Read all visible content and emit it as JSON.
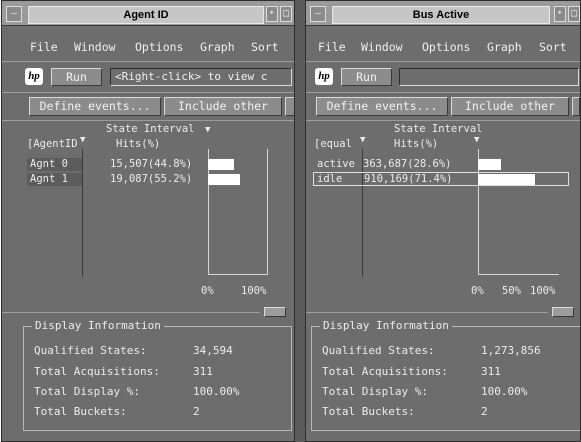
{
  "windows": [
    {
      "title": "Agent ID",
      "menu": [
        "File",
        "Window",
        "Options",
        "Graph",
        "Sort"
      ],
      "run_label": "Run",
      "message": "<Right-click> to view c",
      "define_events_label": "Define events...",
      "include_other_label": "Include other",
      "state_interval_label": "State Interval",
      "col_name": "[AgentID",
      "col_hits": "Hits(%)",
      "rows": [
        {
          "name": "Agnt 0",
          "hits": "15,507(44.8%)",
          "pct": 44.8
        },
        {
          "name": "Agnt 1",
          "hits": "19,087(55.2%)",
          "pct": 55.2
        }
      ],
      "scale_labels": [
        "0%",
        "100%"
      ],
      "display_info_label": "Display Information",
      "info": [
        {
          "label": "Qualified States:",
          "value": "34,594"
        },
        {
          "label": "Total Acquisitions:",
          "value": "311"
        },
        {
          "label": "Total Display %:",
          "value": "100.00%"
        },
        {
          "label": "Total Buckets:",
          "value": "2"
        }
      ]
    },
    {
      "title": "Bus Active",
      "menu": [
        "File",
        "Window",
        "Options",
        "Graph",
        "Sort"
      ],
      "run_label": "Run",
      "message": "",
      "define_events_label": "Define events...",
      "include_other_label": "Include other",
      "state_interval_label": "State Interval",
      "col_name": "[equal",
      "col_hits": "Hits(%)",
      "rows": [
        {
          "name": "active",
          "hits": "363,687(28.6%)",
          "pct": 28.6
        },
        {
          "name": "idle",
          "hits": "910,169(71.4%)",
          "pct": 71.4
        }
      ],
      "scale_labels": [
        "0%",
        "50%",
        "100%"
      ],
      "display_info_label": "Display Information",
      "info": [
        {
          "label": "Qualified States:",
          "value": "1,273,856"
        },
        {
          "label": "Total Acquisitions:",
          "value": "311"
        },
        {
          "label": "Total Display %:",
          "value": "100.00%"
        },
        {
          "label": "Total Buckets:",
          "value": "2"
        }
      ]
    }
  ],
  "icons": {
    "logo": "hp-logo-icon",
    "minimize": "minimize-icon",
    "maximize": "maximize-icon",
    "window_menu": "window-menu-icon"
  },
  "colors": {
    "window_bg": "#6d6d6d",
    "bar": "#ffffff",
    "title_bg": "#c6c6c6"
  }
}
